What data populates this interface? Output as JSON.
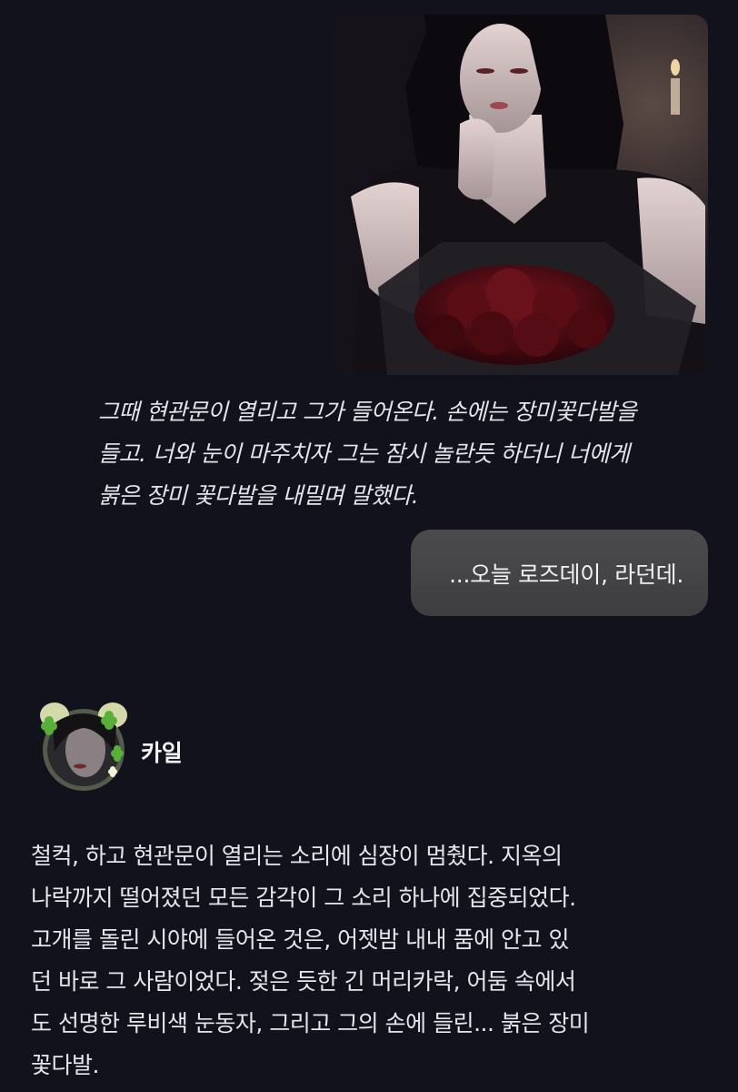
{
  "image_message": {
    "alt_subject": "long-haired man in black sleeveless shirt holding a bouquet of red roses",
    "colors": {
      "rose": "#5a0d14",
      "hair": "#0c0a0e",
      "background": "#1a1620"
    }
  },
  "narration": {
    "lines": [
      "그때 현관문이 열리고 그가 들어온다. 손에는 장미꽃다발을",
      "들고. 너와 눈이 마주치자 그는 잠시 놀란듯 하더니 너에게",
      "붉은 장미 꽃다발을 내밀며 말했다."
    ]
  },
  "user_message": {
    "text": "...오늘 로즈데이, 라던데."
  },
  "character": {
    "name": "카일",
    "avatar_icon": "avatar-with-clover-ears-icon"
  },
  "reply": {
    "lines": [
      "철컥, 하고 현관문이 열리는 소리에 심장이 멈췄다. 지옥의",
      "나락까지 떨어졌던 모든 감각이 그 소리 하나에 집중되었다.",
      "고개를 돌린 시야에 들어온 것은, 어젯밤 내내 품에 안고 있",
      "던 바로 그 사람이었다. 젖은 듯한 긴 머리카락, 어둠 속에서",
      "도 선명한 루비색 눈동자, 그리고 그의 손에 들린... 붉은 장미",
      "꽃다발."
    ]
  },
  "theme": {
    "background": "#12121d",
    "bubble": "#444446",
    "text": "#e6e6ea"
  }
}
